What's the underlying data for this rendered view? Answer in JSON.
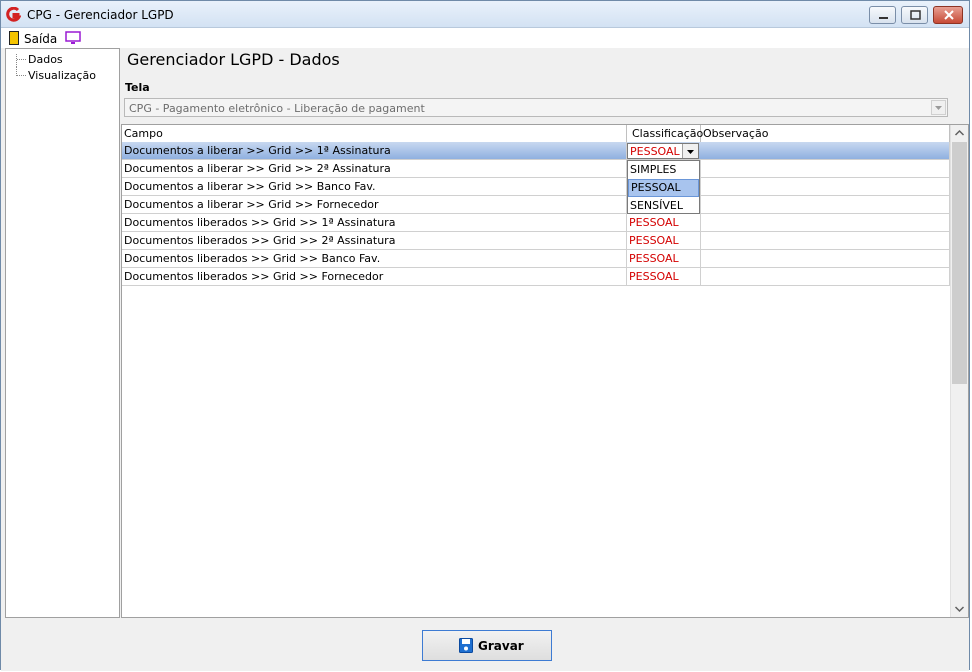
{
  "window": {
    "title": "CPG - Gerenciador LGPD",
    "icon": "app-g-icon",
    "controls": [
      "minimize-icon",
      "maximize-icon",
      "close-icon"
    ]
  },
  "menu": {
    "exit_label": "Saída",
    "exit_icon": "exit-door-icon",
    "monitor_icon": "monitor-icon"
  },
  "tree": {
    "items": [
      {
        "label": "Dados"
      },
      {
        "label": "Visualização"
      }
    ]
  },
  "main": {
    "page_title": "Gerenciador LGPD - Dados",
    "tela_label": "Tela",
    "tela_value": "CPG - Pagamento eletrônico - Liberação de pagament"
  },
  "grid": {
    "columns": [
      "Campo",
      "Classificação",
      "Observação"
    ],
    "rows": [
      {
        "campo": "Documentos a liberar >> Grid >> 1ª Assinatura",
        "classificacao": "PESSOAL",
        "observacao": ""
      },
      {
        "campo": "Documentos a liberar >> Grid >> 2ª Assinatura",
        "classificacao": "",
        "observacao": ""
      },
      {
        "campo": "Documentos a liberar >> Grid >> Banco Fav.",
        "classificacao": "",
        "observacao": ""
      },
      {
        "campo": "Documentos a liberar >> Grid >> Fornecedor",
        "classificacao": "",
        "observacao": ""
      },
      {
        "campo": "Documentos liberados >> Grid >> 1ª Assinatura",
        "classificacao": "PESSOAL",
        "observacao": ""
      },
      {
        "campo": "Documentos liberados >> Grid >> 2ª Assinatura",
        "classificacao": "PESSOAL",
        "observacao": ""
      },
      {
        "campo": "Documentos liberados >> Grid >> Banco Fav.",
        "classificacao": "PESSOAL",
        "observacao": ""
      },
      {
        "campo": "Documentos liberados >> Grid >> Fornecedor",
        "classificacao": "PESSOAL",
        "observacao": ""
      }
    ],
    "editor_value": "PESSOAL",
    "dropdown_options": [
      "SIMPLES",
      "PESSOAL",
      "SENSÍVEL"
    ],
    "dropdown_highlighted": "PESSOAL"
  },
  "footer": {
    "save_label": "Gravar",
    "save_icon": "floppy-disk-icon"
  },
  "colors": {
    "classification_text": "#d40000",
    "selected_row": "#8fb0e0",
    "button_border": "#3d7bd3"
  }
}
